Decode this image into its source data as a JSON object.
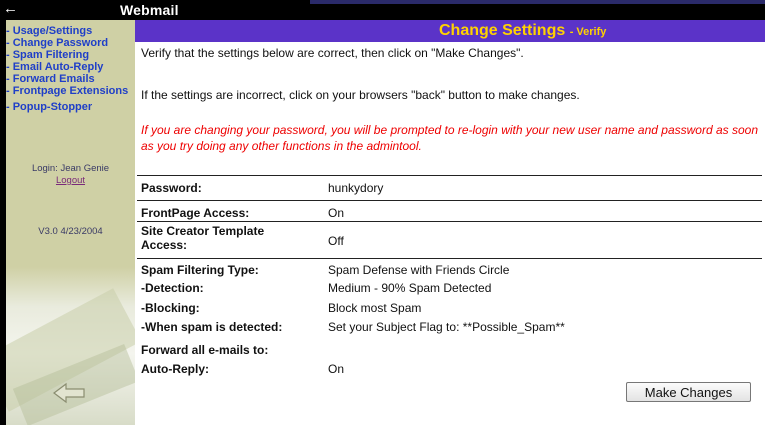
{
  "window": {
    "title": "Webmail"
  },
  "sidebar": {
    "items": [
      {
        "label": "- Usage/Settings"
      },
      {
        "label": "- Change Password"
      },
      {
        "label": "- Spam Filtering"
      },
      {
        "label": "- Email Auto-Reply"
      },
      {
        "label": "- Forward Emails"
      },
      {
        "label": "- Frontpage Extensions"
      },
      {
        "label": "- Popup-Stopper"
      }
    ],
    "login_text": "Login: Jean Genie",
    "logout_label": "Logout",
    "version": "V3.0 4/23/2004"
  },
  "header": {
    "title": "Change Settings",
    "subtitle": "- Verify"
  },
  "intro": {
    "line1": "Verify that the settings below are correct, then click on \"Make Changes\".",
    "line2": "If the settings are incorrect, click on your browsers \"back\" button to make changes.",
    "warning": "If you are changing your password, you will be prompted to re-login with your new user name and password as soon as you try doing any other functions in the admintool."
  },
  "settings": {
    "password": {
      "label": "Password:",
      "value": "hunkydory"
    },
    "frontpage": {
      "label": "FrontPage Access:",
      "value": "On"
    },
    "site_creator": {
      "label": "Site Creator Template Access:",
      "value": "Off"
    },
    "spam_type": {
      "label": "Spam Filtering Type:",
      "value": "Spam Defense with Friends Circle"
    },
    "detection": {
      "label": "-Detection:",
      "value": "Medium - 90% Spam Detected"
    },
    "blocking": {
      "label": "-Blocking:",
      "value": "Block most Spam"
    },
    "when_spam": {
      "label": "-When spam is detected:",
      "value": "Set your Subject Flag to: **Possible_Spam**"
    },
    "forward": {
      "label": "Forward all e-mails to:",
      "value": ""
    },
    "autoreply": {
      "label": "Auto-Reply:",
      "value": "On"
    }
  },
  "actions": {
    "make_changes": "Make Changes"
  },
  "colors": {
    "header_bg": "#5b33c8",
    "header_text": "#ffd200",
    "nav_link": "#1f3fc8",
    "sidebar_bg": "#cfd0a5",
    "warning": "#ee0000"
  }
}
